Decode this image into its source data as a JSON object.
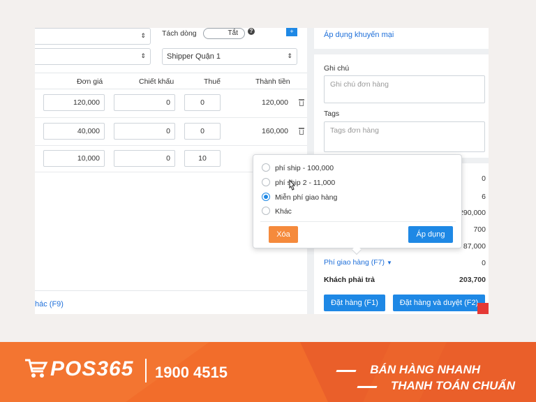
{
  "form": {
    "select_top_left_value": "",
    "select_mid_left_value": "",
    "split_label": "Tách dòng",
    "split_toggle_value": "Tắt",
    "shipper_select_value": "Shipper Quận 1",
    "add_button_label": "+"
  },
  "table": {
    "headers": {
      "unit_price": "Đơn giá",
      "discount": "Chiết khấu",
      "tax": "Thuế",
      "total": "Thành tiền"
    },
    "rows": [
      {
        "price": "120,000",
        "discount": "0",
        "tax": "0",
        "total": "120,000"
      },
      {
        "price": "40,000",
        "discount": "0",
        "tax": "0",
        "total": "160,000"
      },
      {
        "price": "10,000",
        "discount": "0",
        "tax": "10",
        "total": ""
      }
    ],
    "footer_link": "hác (F9)"
  },
  "right": {
    "promo_link": "Áp dụng khuyến mại",
    "note_label": "Ghi chú",
    "note_placeholder": "Ghi chú đơn hàng",
    "tags_label": "Tags",
    "tags_placeholder": "Tags đơn hàng",
    "summary_values": [
      "0",
      "6",
      "290,000",
      "700",
      "87,000"
    ],
    "shipping_link": "Phí giao hàng (F7)",
    "shipping_value": "0",
    "customer_pays_label": "Khách phải trả",
    "customer_pays_value": "203,700",
    "order_button": "Đặt hàng (F1)",
    "order_approve_button": "Đặt hàng và duyệt (F2)"
  },
  "popover": {
    "options": [
      {
        "label": "phí ship - 100,000",
        "checked": false
      },
      {
        "label": "phí ship 2 - 11,000",
        "checked": false
      },
      {
        "label": "Miễn phí giao hàng",
        "checked": true
      },
      {
        "label": "Khác",
        "checked": false
      }
    ],
    "clear_button": "Xóa",
    "apply_button": "Áp dụng"
  },
  "banner": {
    "logo_text": "POS365",
    "hotline": "1900 4515",
    "slogan_line1": "BÁN HÀNG NHANH",
    "slogan_line2": "THANH TOÁN CHUẨN"
  },
  "colors": {
    "accent_blue": "#1e88e5",
    "link_blue": "#1e6fd9",
    "orange_button": "#f58a3c",
    "banner_orange": "#f26d2b"
  }
}
